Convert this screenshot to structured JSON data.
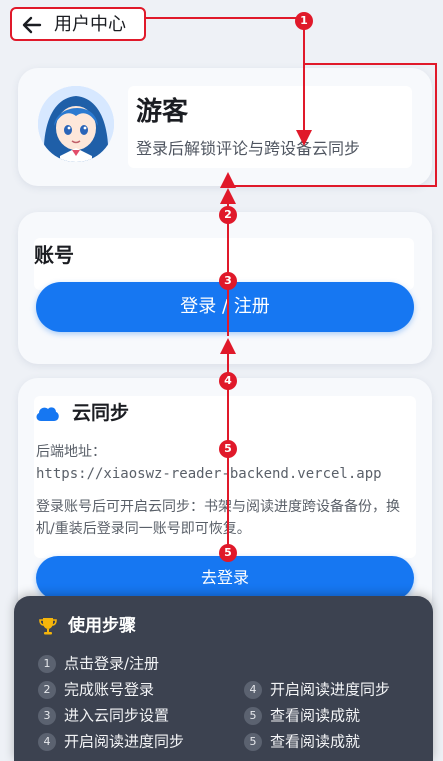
{
  "header": {
    "title": "用户中心",
    "back_icon": "arrow-left-icon"
  },
  "profile": {
    "name": "游客",
    "subtitle": "登录后解锁评论与跨设备云同步",
    "avatar": "anime-avatar"
  },
  "account": {
    "title": "账号",
    "login_button": "登录 / 注册"
  },
  "cloud_sync": {
    "title": "云同步",
    "icon": "cloud-icon",
    "backend_label": "后端地址：",
    "backend_url": "https://xiaoswz-reader-backend.vercel.app",
    "description": "登录账号后可开启云同步：书架与阅读进度跨设备备份，换机/重装后登录同一账号即可恢复。",
    "goto_login_button": "去登录"
  },
  "steps": {
    "title": "使用步骤",
    "icon": "trophy-icon",
    "left": [
      {
        "num": "1",
        "text": "点击登录/注册"
      },
      {
        "num": "2",
        "text": "完成账号登录"
      },
      {
        "num": "3",
        "text": "进入云同步设置"
      },
      {
        "num": "4",
        "text": "开启阅读进度同步"
      }
    ],
    "right": [
      {
        "num": "4",
        "text": "开启阅读进度同步"
      },
      {
        "num": "5",
        "text": "查看阅读成就"
      },
      {
        "num": "5",
        "text": "查看阅读成就"
      }
    ]
  },
  "annotations": {
    "color": "#e0192a",
    "markers": [
      "1",
      "2",
      "3",
      "4",
      "5",
      "5"
    ]
  }
}
